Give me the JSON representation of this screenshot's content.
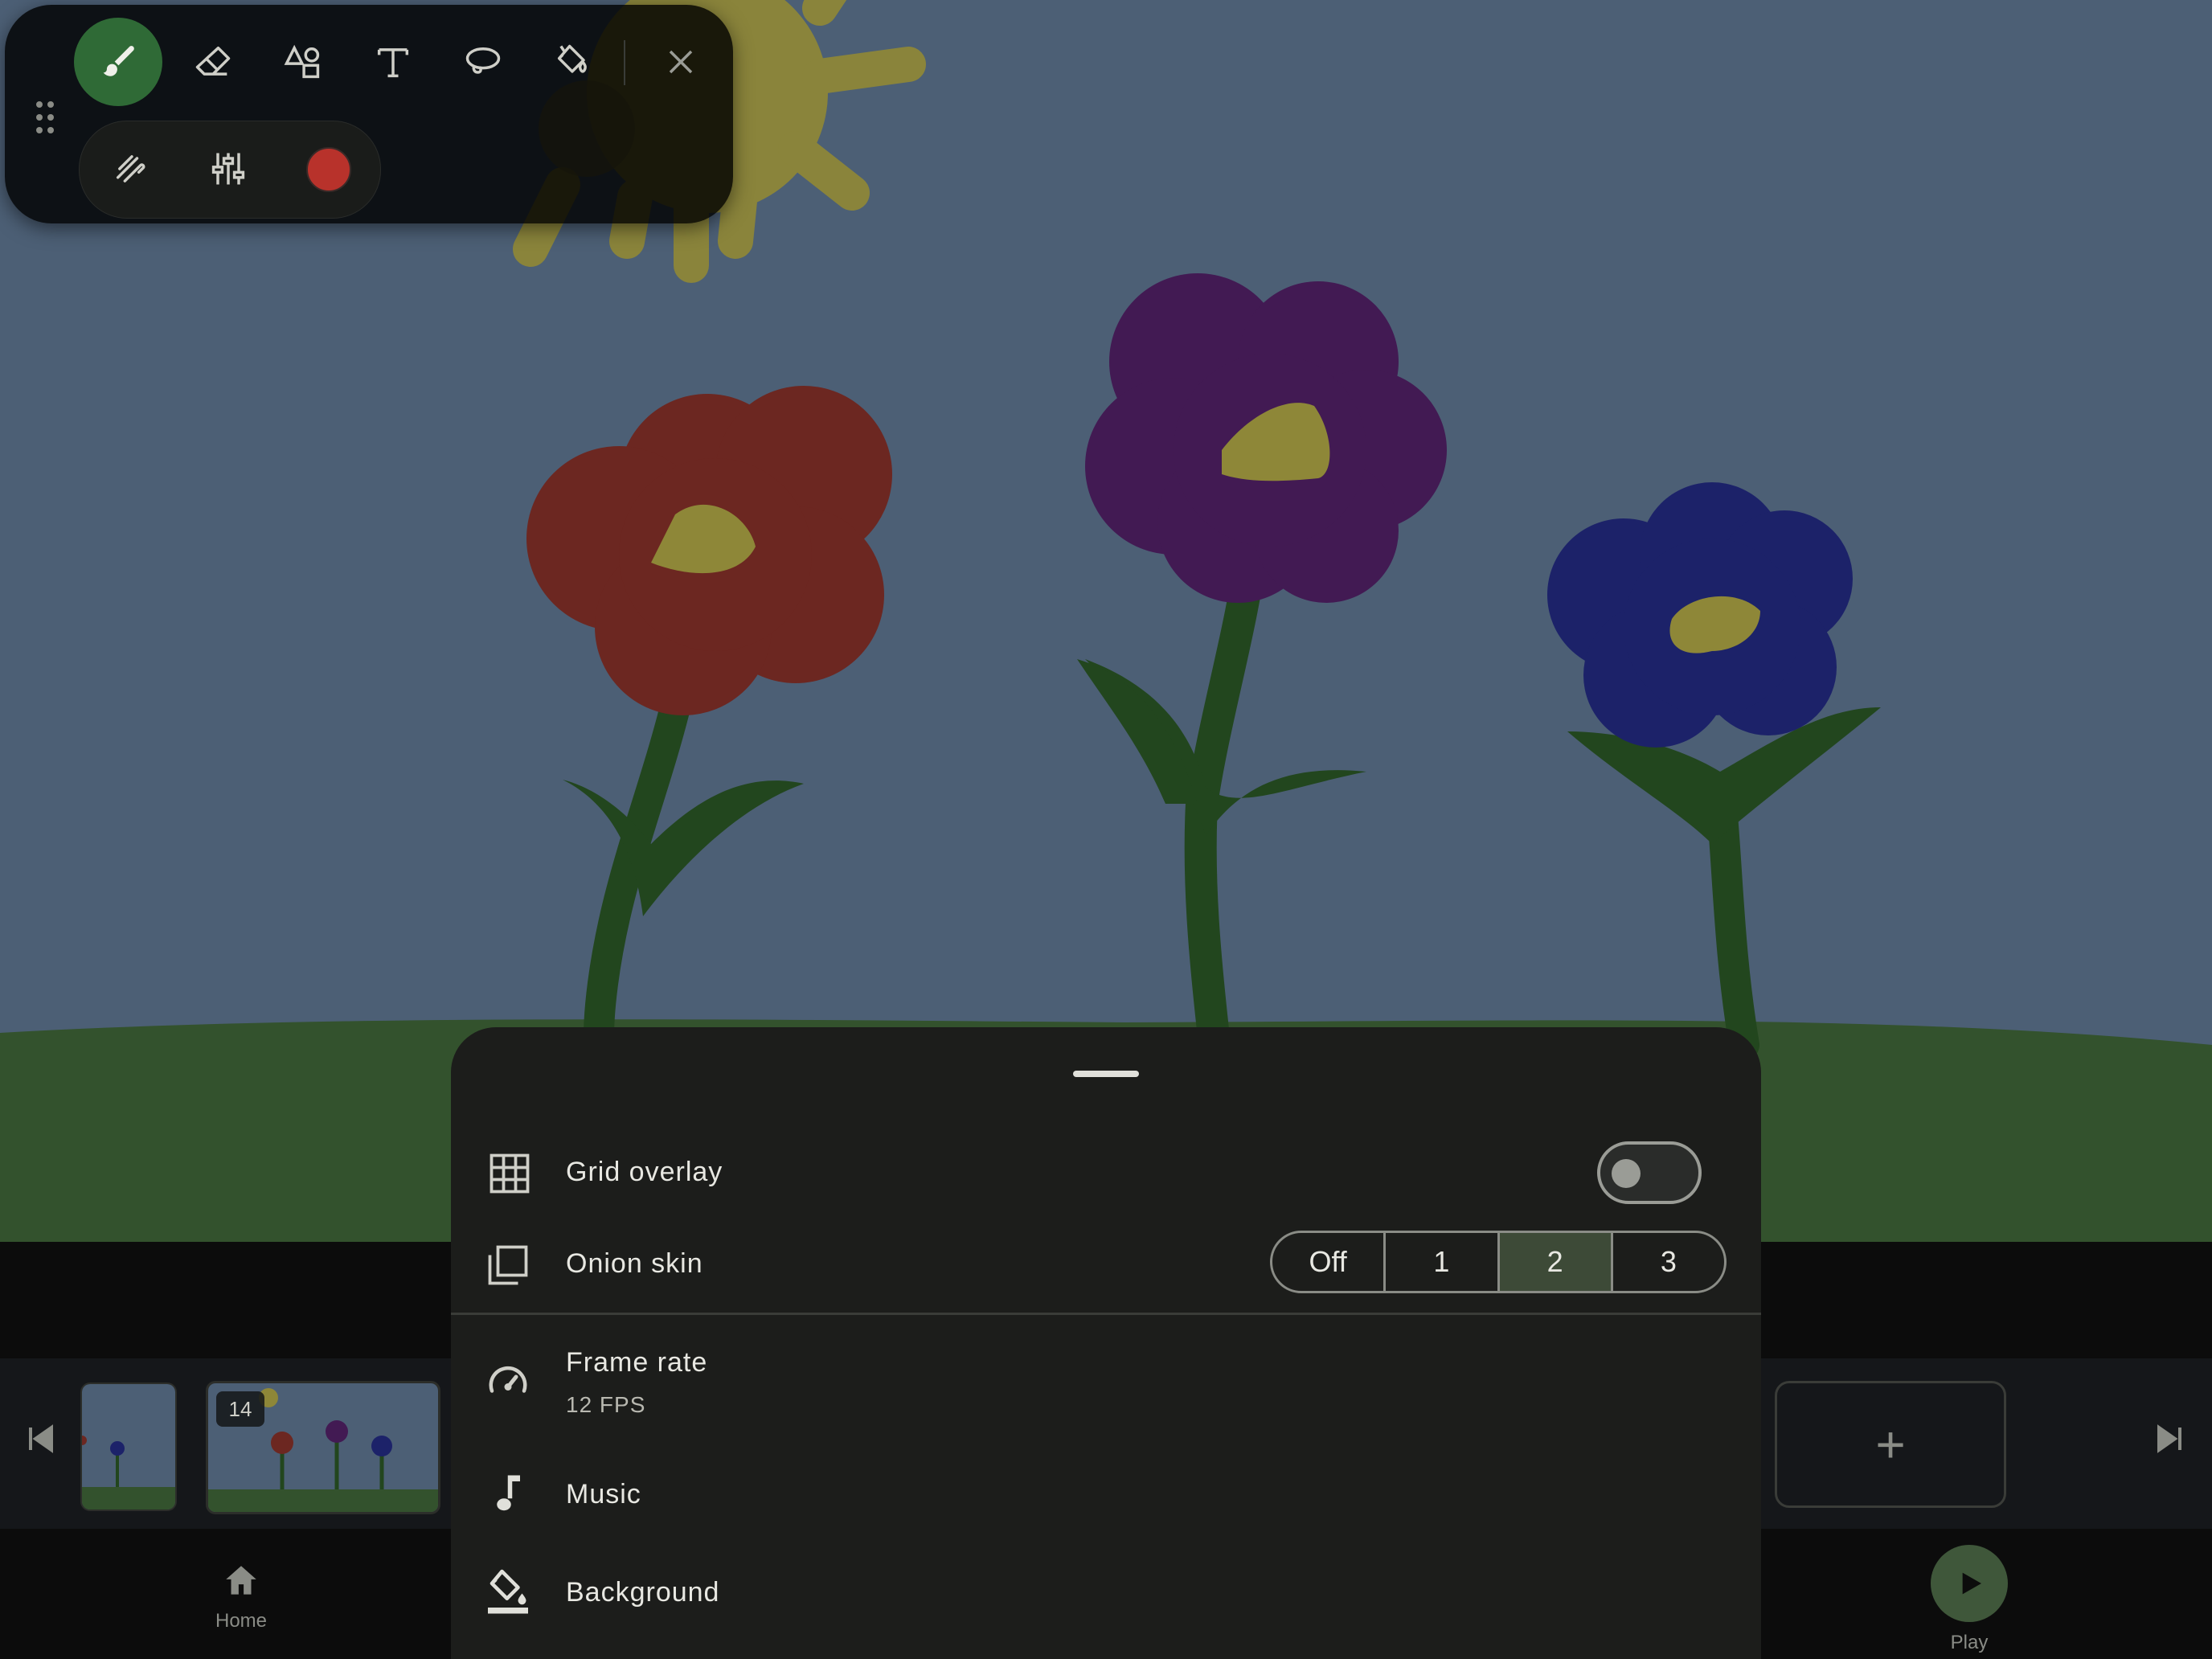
{
  "toolbar": {
    "tools": [
      "brush-icon",
      "eraser-icon",
      "shapes-icon",
      "text-icon",
      "lasso-icon",
      "fill-bucket-icon",
      "close-icon"
    ],
    "active_tool": "brush-icon",
    "sub_tools": [
      "stroke-style-icon",
      "adjust-sliders-icon",
      "color-swatch"
    ],
    "current_color": "#b8322b"
  },
  "timeline": {
    "current_frame_badge": "14",
    "add_frame_label": "+"
  },
  "bottom_nav": {
    "home_label": "Home",
    "play_label": "Play"
  },
  "sheet": {
    "grid_overlay": {
      "label": "Grid overlay",
      "enabled": false
    },
    "onion_skin": {
      "label": "Onion skin",
      "options": [
        "Off",
        "1",
        "2",
        "3"
      ],
      "selected": "2"
    },
    "frame_rate": {
      "label": "Frame rate",
      "value": "12 FPS"
    },
    "music": {
      "label": "Music"
    },
    "background": {
      "label": "Background"
    }
  },
  "colors": {
    "accent_green": "#2f6a36",
    "sky": "#4c5f75",
    "grass": "#33522d"
  }
}
